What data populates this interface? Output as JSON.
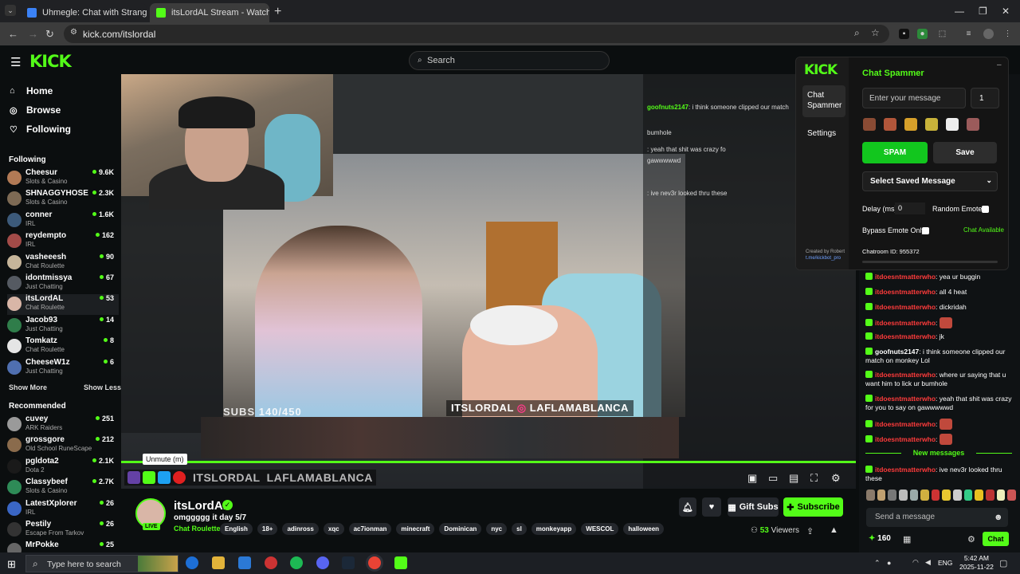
{
  "browser": {
    "tabs": [
      {
        "title": "Uhmegle: Chat with Strangers |"
      },
      {
        "title": "itsLordAL Stream - Watch Live o"
      }
    ],
    "url": "kick.com/itslordal"
  },
  "kick": {
    "logo": "KICK",
    "search_placeholder": "Search",
    "nav": [
      "Home",
      "Browse",
      "Following"
    ],
    "following_label": "Following",
    "following": [
      {
        "name": "Cheesur",
        "category": "Slots & Casino",
        "viewers": "9.6K",
        "color": "#b27a55"
      },
      {
        "name": "SHNAGGYHOSE",
        "category": "Slots & Casino",
        "viewers": "2.3K",
        "color": "#7d6a54"
      },
      {
        "name": "conner",
        "category": "IRL",
        "viewers": "1.6K",
        "color": "#3c5a7a"
      },
      {
        "name": "reydempto",
        "category": "IRL",
        "viewers": "162",
        "color": "#a34b48"
      },
      {
        "name": "vasheeesh",
        "category": "Chat Roulette",
        "viewers": "90",
        "color": "#c6b59a"
      },
      {
        "name": "idontmissya",
        "category": "Just Chatting",
        "viewers": "67",
        "color": "#555a62"
      },
      {
        "name": "itsLordAL",
        "category": "Chat Roulette",
        "viewers": "53",
        "color": "#d9b6a7"
      },
      {
        "name": "Jacob93",
        "category": "Just Chatting",
        "viewers": "14",
        "color": "#2f7d4a"
      },
      {
        "name": "Tomkatz",
        "category": "Chat Roulette",
        "viewers": "8",
        "color": "#e5e5e5"
      },
      {
        "name": "CheeseW1z",
        "category": "Just Chatting",
        "viewers": "6",
        "color": "#4f6fb0"
      }
    ],
    "show_more": "Show More",
    "show_less": "Show Less",
    "recommended_label": "Recommended",
    "recommended": [
      {
        "name": "cuvey",
        "category": "ARK Raiders",
        "viewers": "251",
        "color": "#9a9a9a"
      },
      {
        "name": "grossgore",
        "category": "Old School RuneScape",
        "viewers": "212",
        "color": "#8a6b4c"
      },
      {
        "name": "pgldota2",
        "category": "Dota 2",
        "viewers": "2.1K",
        "color": "#1a1a1a"
      },
      {
        "name": "Classybeef",
        "category": "Slots & Casino",
        "viewers": "2.7K",
        "color": "#2e8b57"
      },
      {
        "name": "LatestXplorer",
        "category": "IRL",
        "viewers": "26",
        "color": "#3a66c4"
      },
      {
        "name": "Pestily",
        "category": "Escape From Tarkov",
        "viewers": "26",
        "color": "#333333"
      },
      {
        "name": "MrPokke",
        "category": "",
        "viewers": "25",
        "color": "#666666"
      }
    ]
  },
  "video": {
    "subs_overlay": "SUBS 140/450",
    "handle_overlay": "ITSLORDAL",
    "handle_overlay2": "LAFLAMABLANCA",
    "tooltip": "Unmute (m)"
  },
  "ghost_chat": [
    {
      "user": "goofnuts2147",
      "text": ": i think someone clipped our match"
    },
    {
      "user": "",
      "text": "bumhole"
    },
    {
      "user": "",
      "text": ": yeah that shit was crazy fo"
    },
    {
      "user": "",
      "text": "gawwwwwd"
    },
    {
      "user": "",
      "text": ": ive nev3r looked thru these"
    }
  ],
  "stream": {
    "name": "itsLordAL",
    "live_badge": "LIVE",
    "title": "omggggg it day 5/7",
    "category": "Chat Roulette",
    "tags": [
      "English",
      "18+",
      "adinross",
      "xqc",
      "ac7ionman",
      "minecraft",
      "Dominican",
      "nyc",
      "sl",
      "monkeyapp",
      "WESCOL",
      "halloween"
    ],
    "gift_subs": "Gift Subs",
    "subscribe": "Subscribe",
    "viewers": "53",
    "viewers_label": "Viewers"
  },
  "chat": {
    "messages": [
      {
        "user": "itdoesntmatterwho",
        "text": ": yea ur buggin",
        "emote": false
      },
      {
        "user": "itdoesntmatterwho",
        "text": ": all 4 heat",
        "emote": false
      },
      {
        "user": "itdoesntmatterwho",
        "text": ": dickridah",
        "emote": false
      },
      {
        "user": "itdoesntmatterwho",
        "text": ":",
        "emote": true
      },
      {
        "user": "itdoesntmatterwho",
        "text": ": jk",
        "emote": false
      },
      {
        "user": "goofnuts2147",
        "text": ": i think someone clipped our match on monkey Lol",
        "emote": false,
        "white": true
      },
      {
        "user": "itdoesntmatterwho",
        "text": ": where ur saying that u want him to lick ur bumhole",
        "emote": false
      },
      {
        "user": "itdoesntmatterwho",
        "text": ": yeah that shit was crazy for you to say on gawwwwwd",
        "emote": false
      },
      {
        "user": "itdoesntmatterwho",
        "text": ":",
        "emote": true
      },
      {
        "user": "itdoesntmatterwho",
        "text": ":",
        "emote": true
      }
    ],
    "new_messages": "New messages",
    "last_message": {
      "user": "itdoesntmatterwho",
      "text": ": ive nev3r looked thru these"
    },
    "send_placeholder": "Send a message",
    "points": "160",
    "chat_button": "Chat"
  },
  "spammer": {
    "logo": "KICK",
    "tab_chat_spammer": "Chat Spammer",
    "tab_settings": "Settings",
    "title": "Chat Spammer",
    "message_placeholder": "Enter your message",
    "count": "1",
    "spam_button": "SPAM",
    "save_button": "Save",
    "select_saved": "Select Saved Message",
    "delay_label": "Delay (ms):",
    "delay_value": "0",
    "random_emote": "Random Emote:",
    "bypass_emote": "Bypass Emote Only:",
    "chat_available": "Chat Available",
    "created_by": "Created by Robert",
    "created_link": "t.me/kickbot_pro",
    "chatroom_id": "Chatroom ID: 955372"
  },
  "taskbar": {
    "search_placeholder": "Type here to search",
    "lang": "ENG",
    "time": "5:42 AM",
    "date": "2025-11-22"
  },
  "colors": {
    "kick_green": "#53fc18",
    "chat_red": "#ff3b3b",
    "background": "#0b0e0f"
  }
}
